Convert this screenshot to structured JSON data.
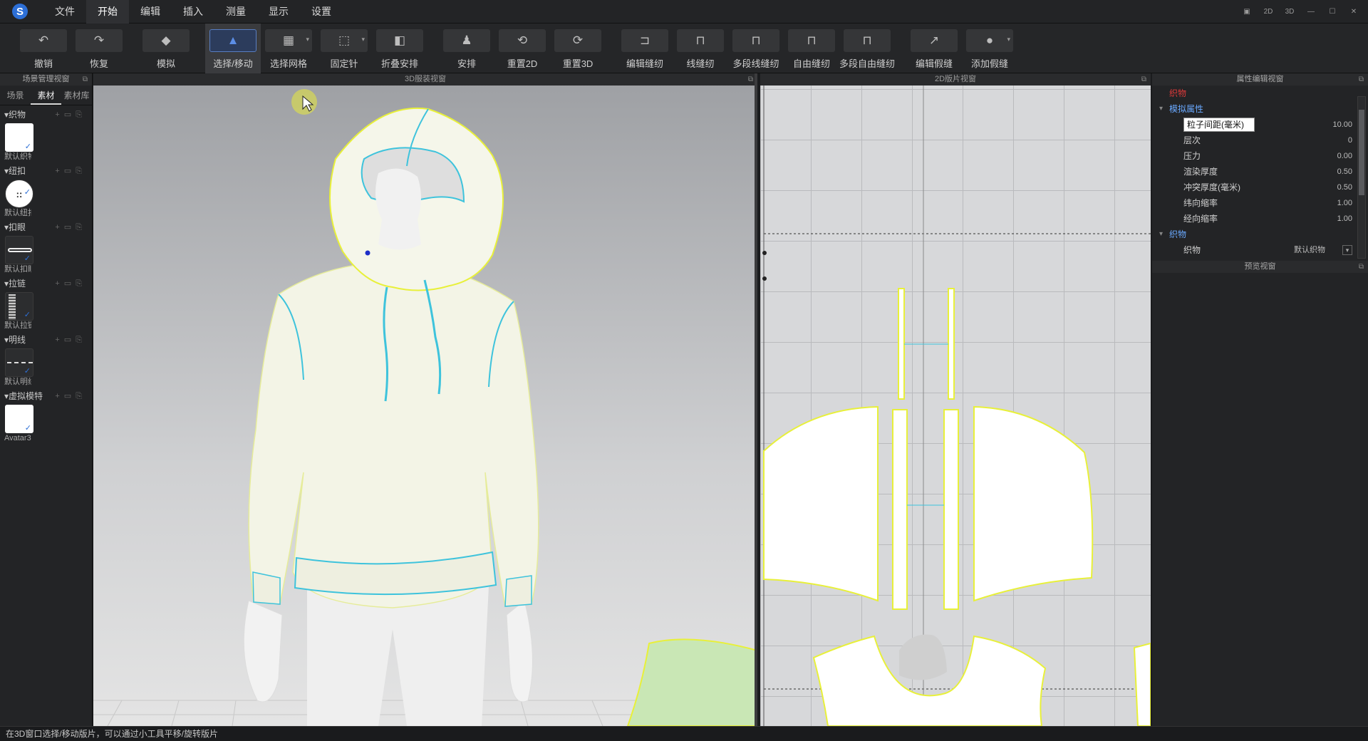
{
  "menubar": {
    "logo": "S",
    "items": [
      "文件",
      "开始",
      "编辑",
      "插入",
      "测量",
      "显示",
      "设置"
    ],
    "active_index": 1,
    "window_controls": [
      "▣",
      "2D",
      "3D",
      "—",
      "☐",
      "✕"
    ]
  },
  "toolbar": {
    "tools": [
      {
        "label": "撤销",
        "icon": "undo-icon",
        "glyph": "↶"
      },
      {
        "label": "恢复",
        "icon": "redo-icon",
        "glyph": "↷"
      },
      {
        "label": "模拟",
        "icon": "simulate-icon",
        "glyph": "◆"
      },
      {
        "label": "选择/移动",
        "icon": "select-move-icon",
        "glyph": "▲",
        "active": true
      },
      {
        "label": "选择网格",
        "icon": "select-mesh-icon",
        "glyph": "▦",
        "dropdown": true
      },
      {
        "label": "固定针",
        "icon": "pin-icon",
        "glyph": "⬚",
        "dropdown": true
      },
      {
        "label": "折叠安排",
        "icon": "fold-arrange-icon",
        "glyph": "◧"
      },
      {
        "label": "安排",
        "icon": "arrange-icon",
        "glyph": "♟"
      },
      {
        "label": "重置2D",
        "icon": "reset-2d-icon",
        "glyph": "⟲"
      },
      {
        "label": "重置3D",
        "icon": "reset-3d-icon",
        "glyph": "⟳"
      },
      {
        "label": "编辑缝纫",
        "icon": "edit-sewing-icon",
        "glyph": "⊐"
      },
      {
        "label": "线缝纫",
        "icon": "segment-sewing-icon",
        "glyph": "⊓"
      },
      {
        "label": "多段线缝纫",
        "icon": "multi-segment-sewing-icon",
        "glyph": "⊓"
      },
      {
        "label": "自由缝纫",
        "icon": "free-sewing-icon",
        "glyph": "⊓"
      },
      {
        "label": "多段自由缝纫",
        "icon": "multi-free-sewing-icon",
        "glyph": "⊓"
      },
      {
        "label": "编辑假缝",
        "icon": "edit-tack-icon",
        "glyph": "↗"
      },
      {
        "label": "添加假缝",
        "icon": "add-tack-icon",
        "glyph": "●",
        "dropdown": true
      }
    ]
  },
  "left_panel": {
    "title": "场景管理视窗",
    "tabs": [
      "场景",
      "素材",
      "素材库"
    ],
    "active_tab": 1,
    "categories": [
      {
        "label": "织物",
        "item": "默认织物",
        "kind": "white"
      },
      {
        "label": "纽扣",
        "item": "默认纽扣",
        "kind": "button"
      },
      {
        "label": "扣眼",
        "item": "默认扣眼",
        "kind": "buttonhole"
      },
      {
        "label": "拉链",
        "item": "默认拉链",
        "kind": "zipper"
      },
      {
        "label": "明线",
        "item": "默认明线",
        "kind": "topstitch"
      },
      {
        "label": "虚拟模特",
        "item": "Avatar3",
        "kind": "white"
      }
    ]
  },
  "view3d": {
    "title": "3D服装视窗"
  },
  "view2d": {
    "title": "2D版片视窗"
  },
  "right_panel": {
    "title": "属性编辑视窗",
    "red_label": "织物",
    "sections": [
      {
        "label": "模拟属性",
        "rows": [
          {
            "key": "粒子间距(毫米)",
            "value": "10.00",
            "selected": true
          },
          {
            "key": "层次",
            "value": "0"
          },
          {
            "key": "压力",
            "value": "0.00"
          },
          {
            "key": "渲染厚度",
            "value": "0.50"
          },
          {
            "key": "冲突厚度(毫米)",
            "value": "0.50"
          },
          {
            "key": "纬向缩率",
            "value": "1.00"
          },
          {
            "key": "经向缩率",
            "value": "1.00"
          }
        ]
      },
      {
        "label": "织物",
        "rows": [
          {
            "key": "织物",
            "value": "默认织物",
            "dropdown": true
          }
        ]
      }
    ],
    "preview_title": "预览视窗"
  },
  "statusbar": {
    "text": "在3D窗口选择/移动版片，可以通过小工具平移/旋转版片"
  },
  "colors": {
    "accent": "#2d6fd6",
    "seam_yellow": "#e8f03a",
    "seam_cyan": "#3ec3dc",
    "highlight_blue": "#6aa9ff"
  }
}
